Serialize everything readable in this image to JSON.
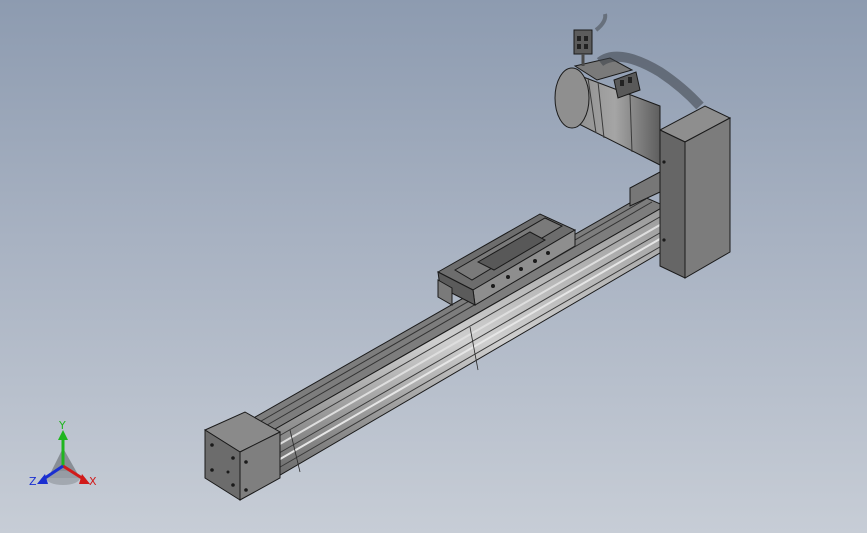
{
  "viewport": {
    "background_top": "#8d9bb0",
    "background_bottom": "#c7cdd6"
  },
  "model": {
    "part_color": "#6f6f6f",
    "rail_color": "#8a8a8a",
    "highlight_color": "#c4c4c4",
    "shadow_color": "#4a4a4a",
    "edge_color": "#1a1a1a"
  },
  "triad": {
    "x_label": "X",
    "y_label": "Y",
    "z_label": "Z",
    "x_color": "#d11a1a",
    "y_color": "#1fb51f",
    "z_color": "#1a2fd1"
  }
}
